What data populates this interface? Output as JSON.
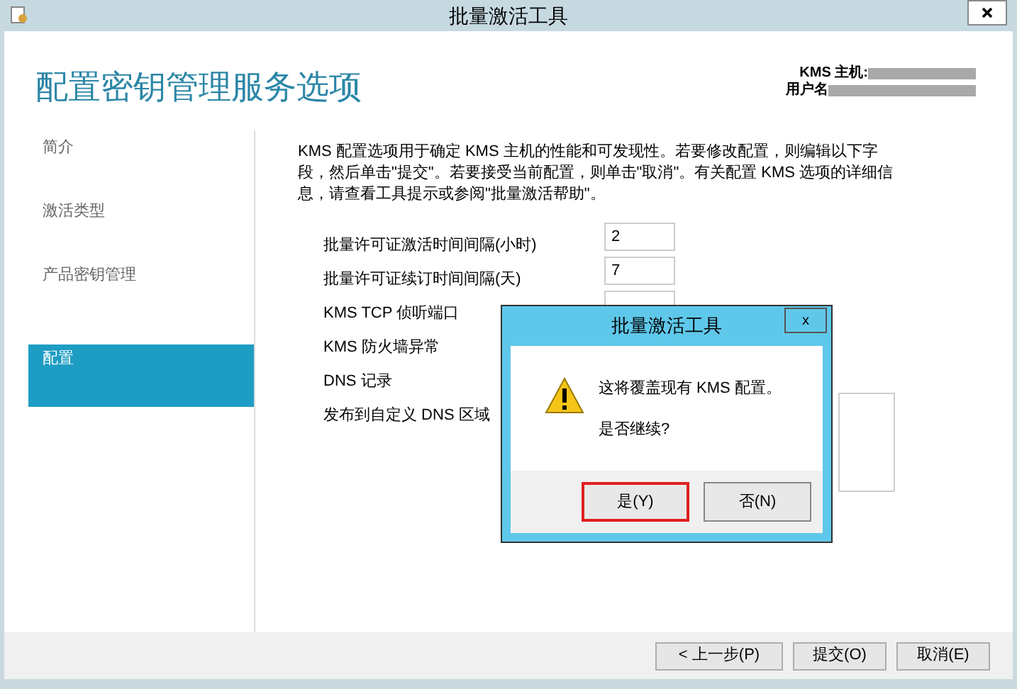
{
  "window": {
    "title": "批量激活工具"
  },
  "header": {
    "title": "配置密钥管理服务选项",
    "host_label": "KMS 主机:",
    "user_label": "用户名"
  },
  "sidebar": {
    "items": [
      {
        "label": "简介",
        "selected": false
      },
      {
        "label": "激活类型",
        "selected": false
      },
      {
        "label": "产品密钥管理",
        "selected": false
      },
      {
        "label": "配置",
        "selected": true
      }
    ]
  },
  "description": "KMS 配置选项用于确定 KMS 主机的性能和可发现性。若要修改配置，则编辑以下字段，然后单击\"提交\"。若要接受当前配置，则单击\"取消\"。有关配置 KMS 选项的详细信息，请查看工具提示或参阅\"批量激活帮助\"。",
  "settings": [
    {
      "label": "批量许可证激活时间间隔(小时)",
      "kind": "field",
      "value": "2"
    },
    {
      "label": "批量许可证续订时间间隔(天)",
      "kind": "field",
      "value": "7"
    },
    {
      "label": "KMS TCP 侦听端口",
      "kind": "field"
    },
    {
      "label": "KMS 防火墙异常",
      "kind": "text"
    },
    {
      "label": "DNS 记录",
      "kind": "text"
    },
    {
      "label": "发布到自定义 DNS 区域",
      "kind": "area"
    }
  ],
  "buttons": [
    {
      "label": "< 上一步(P)"
    },
    {
      "label": "提交(O)"
    },
    {
      "label": "取消(E)"
    }
  ],
  "dialog": {
    "title": "批量激活工具",
    "close": "x",
    "message": "这将覆盖现有 KMS 配置。",
    "question": "是否继续?",
    "buttons": [
      {
        "label": "是(Y)",
        "selected": true
      },
      {
        "label": "否(N)",
        "selected": false
      }
    ]
  }
}
